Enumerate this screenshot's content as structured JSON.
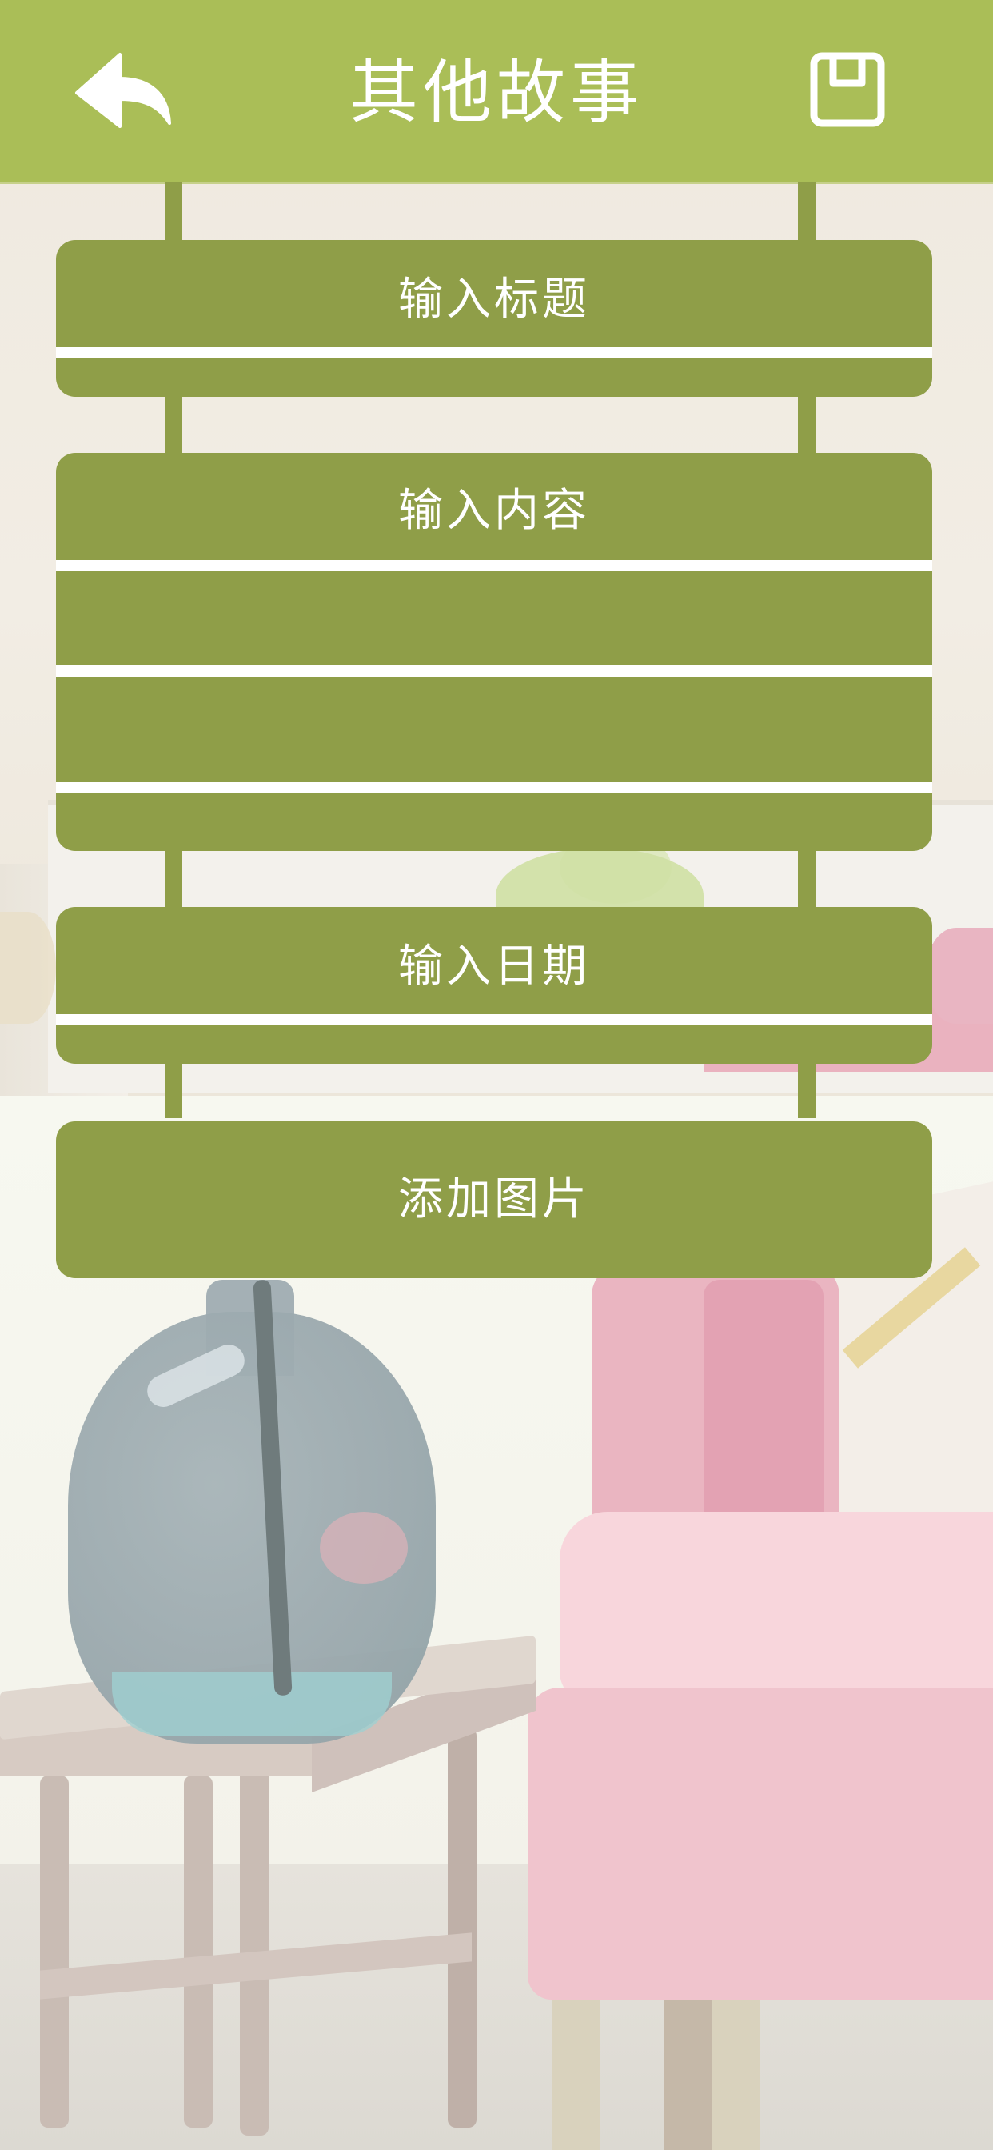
{
  "header": {
    "title": "其他故事",
    "back_icon": "reply-arrow-icon",
    "save_icon": "floppy-save-icon"
  },
  "form": {
    "title_placeholder": "输入标题",
    "content_placeholder": "输入内容",
    "date_placeholder": "输入日期",
    "add_image_label": "添加图片"
  },
  "colors": {
    "header_bg": "#aabe57",
    "card_bg": "#8f9e48",
    "text": "#ffffff"
  }
}
